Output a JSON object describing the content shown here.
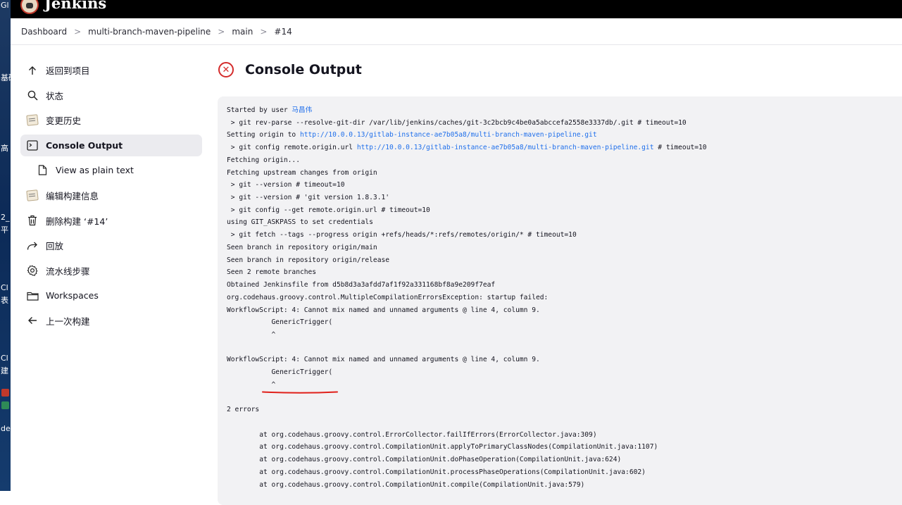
{
  "desktop": {
    "labels": [
      "Gl",
      "基础",
      "高",
      "2_",
      "平",
      "Cl",
      "表",
      "Cl",
      "建",
      "de"
    ]
  },
  "header": {
    "brand": "Jenkins"
  },
  "breadcrumb": {
    "items": [
      "Dashboard",
      "multi-branch-maven-pipeline",
      "main",
      "#14"
    ],
    "separator": ">"
  },
  "sidebar": {
    "items": [
      {
        "label": "返回到项目",
        "icon": "arrow-up-icon"
      },
      {
        "label": "状态",
        "icon": "search-icon"
      },
      {
        "label": "变更历史",
        "icon": "notepad-icon"
      },
      {
        "label": "Console Output",
        "icon": "terminal-icon",
        "active": true
      },
      {
        "label": "View as plain text",
        "icon": "document-icon",
        "sub": true
      },
      {
        "label": "编辑构建信息",
        "icon": "notepad-icon"
      },
      {
        "label": "删除构建 ‘#14’",
        "icon": "trash-icon"
      },
      {
        "label": "回放",
        "icon": "replay-icon"
      },
      {
        "label": "流水线步骤",
        "icon": "gear-icon"
      },
      {
        "label": "Workspaces",
        "icon": "folder-icon"
      },
      {
        "label": "上一次构建",
        "icon": "arrow-left-icon"
      }
    ]
  },
  "main": {
    "title": "Console Output",
    "status_color": "#d42b2b"
  },
  "console": {
    "lines": [
      {
        "text": "Started by user ",
        "link": "马昌伟",
        "after": ""
      },
      {
        "text": " > git rev-parse --resolve-git-dir /var/lib/jenkins/caches/git-3c2bcb9c4be0a5abccefa2558e3337db/.git # timeout=10"
      },
      {
        "text": "Setting origin to ",
        "link": "http://10.0.0.13/gitlab-instance-ae7b05a8/multi-branch-maven-pipeline.git",
        "after": ""
      },
      {
        "text": " > git config remote.origin.url ",
        "link": "http://10.0.0.13/gitlab-instance-ae7b05a8/multi-branch-maven-pipeline.git",
        "after": " # timeout=10"
      },
      {
        "text": "Fetching origin..."
      },
      {
        "text": "Fetching upstream changes from origin"
      },
      {
        "text": " > git --version # timeout=10"
      },
      {
        "text": " > git --version # 'git version 1.8.3.1'"
      },
      {
        "text": " > git config --get remote.origin.url # timeout=10"
      },
      {
        "text": "using GIT_ASKPASS to set credentials"
      },
      {
        "text": " > git fetch --tags --progress origin +refs/heads/*:refs/remotes/origin/* # timeout=10"
      },
      {
        "text": "Seen branch in repository origin/main"
      },
      {
        "text": "Seen branch in repository origin/release"
      },
      {
        "text": "Seen 2 remote branches"
      },
      {
        "text": "Obtained Jenkinsfile from d5b8d3a3afdd7af1f92a331168bf8a9e209f7eaf"
      },
      {
        "text": "org.codehaus.groovy.control.MultipleCompilationErrorsException: startup failed:"
      },
      {
        "text": "WorkflowScript: 4: Cannot mix named and unnamed arguments @ line 4, column 9."
      },
      {
        "text": "           GenericTrigger("
      },
      {
        "text": "           ^"
      },
      {
        "text": ""
      },
      {
        "text": "WorkflowScript: 4: Cannot mix named and unnamed arguments @ line 4, column 9."
      },
      {
        "text": "           GenericTrigger("
      },
      {
        "text": "           ^"
      },
      {
        "text": ""
      },
      {
        "text": "2 errors"
      },
      {
        "text": ""
      },
      {
        "text": "        at org.codehaus.groovy.control.ErrorCollector.failIfErrors(ErrorCollector.java:309)"
      },
      {
        "text": "        at org.codehaus.groovy.control.CompilationUnit.applyToPrimaryClassNodes(CompilationUnit.java:1107)"
      },
      {
        "text": "        at org.codehaus.groovy.control.CompilationUnit.doPhaseOperation(CompilationUnit.java:624)"
      },
      {
        "text": "        at org.codehaus.groovy.control.CompilationUnit.processPhaseOperations(CompilationUnit.java:602)"
      },
      {
        "text": "        at org.codehaus.groovy.control.CompilationUnit.compile(CompilationUnit.java:579)"
      }
    ],
    "annotation_color": "#e0201a"
  }
}
